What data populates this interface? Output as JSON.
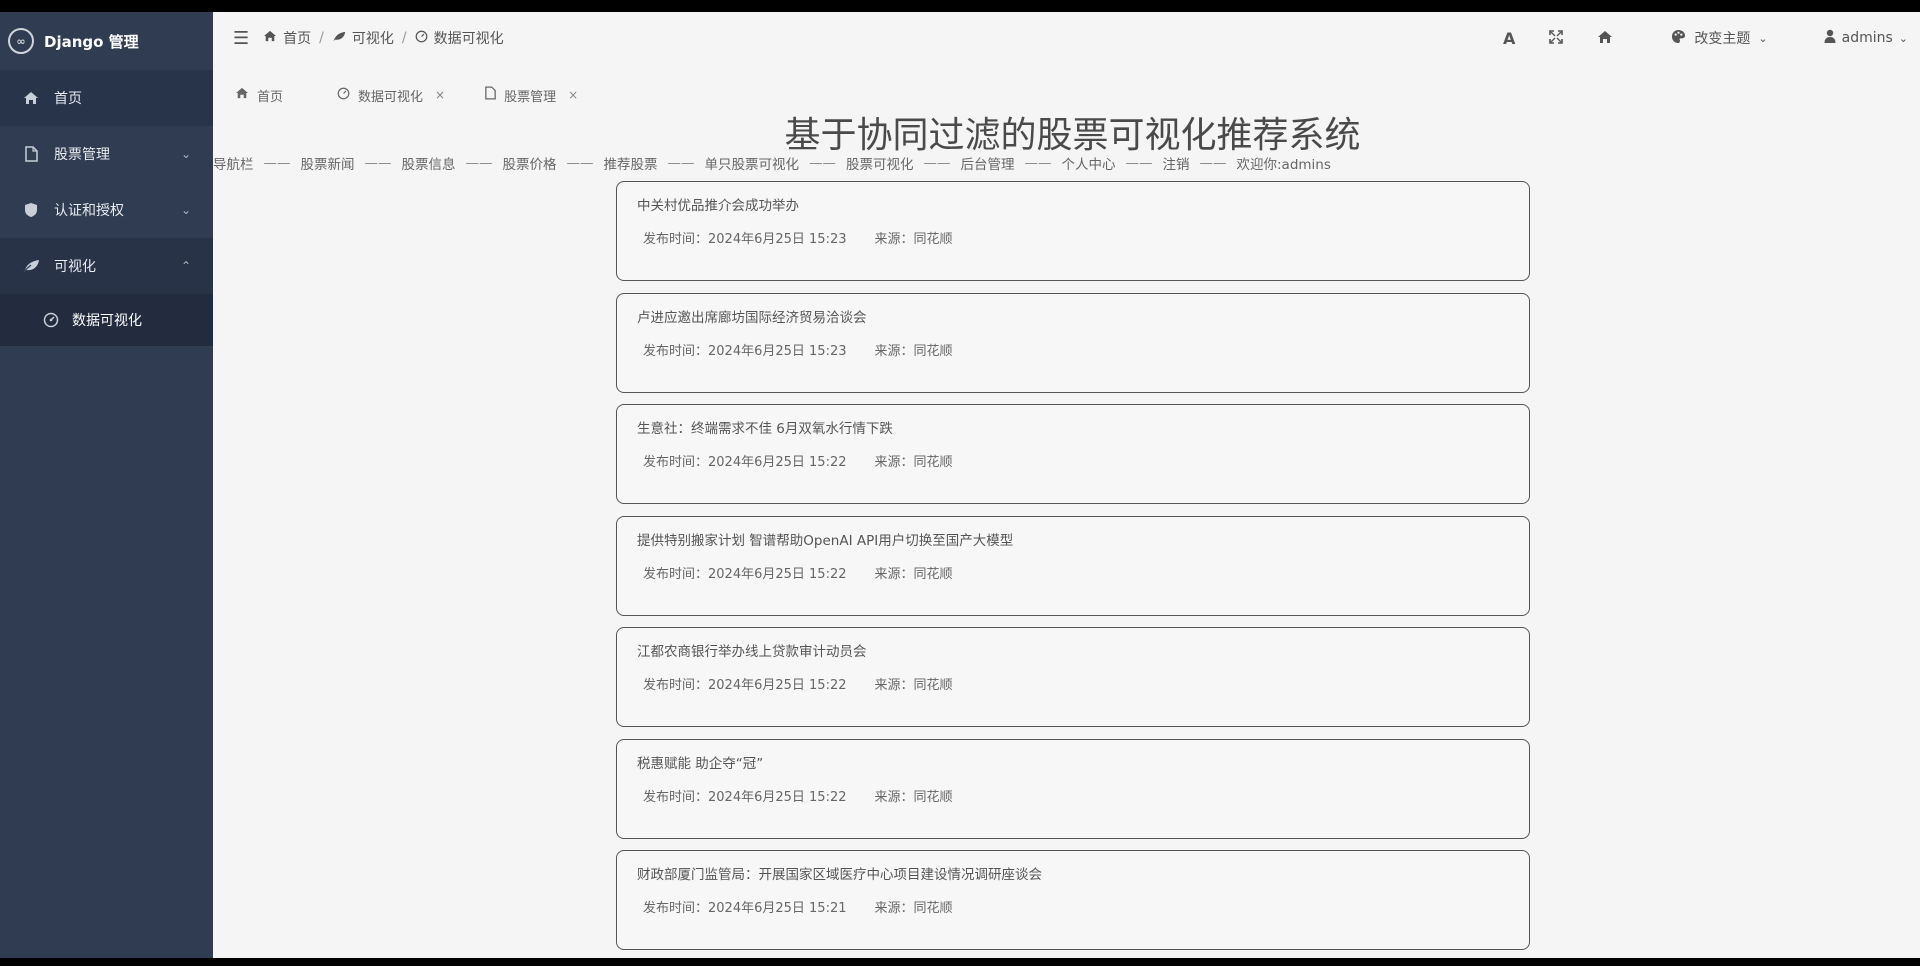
{
  "brand": {
    "title": "Django 管理",
    "logo_text": "∞"
  },
  "sidebar": {
    "items": [
      {
        "label": "首页",
        "icon": "home-icon",
        "chevron": ""
      },
      {
        "label": "股票管理",
        "icon": "file-icon",
        "chevron": "⌄"
      },
      {
        "label": "认证和授权",
        "icon": "shield-icon",
        "chevron": "⌄"
      },
      {
        "label": "可视化",
        "icon": "leaf-icon",
        "chevron": "⌃"
      }
    ],
    "sub_item": {
      "label": "数据可视化",
      "icon": "dashboard-icon"
    }
  },
  "topbar": {
    "breadcrumb": [
      "首页",
      "可视化",
      "数据可视化"
    ],
    "theme_label": "改变主题",
    "user_label": "admins"
  },
  "tabs": [
    {
      "label": "首页",
      "closable": false
    },
    {
      "label": "数据可视化",
      "closable": true
    },
    {
      "label": "股票管理",
      "closable": true
    }
  ],
  "main": {
    "title": "基于协同过滤的股票可视化推荐系统",
    "nav": [
      "导航栏",
      "股票新闻",
      "股票信息",
      "股票价格",
      "推荐股票",
      "单只股票可视化",
      "股票可视化",
      "后台管理",
      "个人中心",
      "注销",
      "欢迎你:admins"
    ],
    "nav_separator": "——"
  },
  "news": [
    {
      "title": "中关村优品推介会成功举办",
      "time": "发布时间：2024年6月25日 15:23",
      "source": "来源：同花顺"
    },
    {
      "title": "卢进应邀出席廊坊国际经济贸易洽谈会",
      "time": "发布时间：2024年6月25日 15:23",
      "source": "来源：同花顺"
    },
    {
      "title": "生意社：终端需求不佳 6月双氧水行情下跌",
      "time": "发布时间：2024年6月25日 15:22",
      "source": "来源：同花顺"
    },
    {
      "title": "提供特别搬家计划 智谱帮助OpenAI API用户切换至国产大模型",
      "time": "发布时间：2024年6月25日 15:22",
      "source": "来源：同花顺"
    },
    {
      "title": "江都农商银行举办线上贷款审计动员会",
      "time": "发布时间：2024年6月25日 15:22",
      "source": "来源：同花顺"
    },
    {
      "title": "税惠赋能 助企夺“冠”",
      "time": "发布时间：2024年6月25日 15:22",
      "source": "来源：同花顺"
    },
    {
      "title": "财政部厦门监管局：开展国家区域医疗中心项目建设情况调研座谈会",
      "time": "发布时间：2024年6月25日 15:21",
      "source": "来源：同花顺"
    }
  ]
}
